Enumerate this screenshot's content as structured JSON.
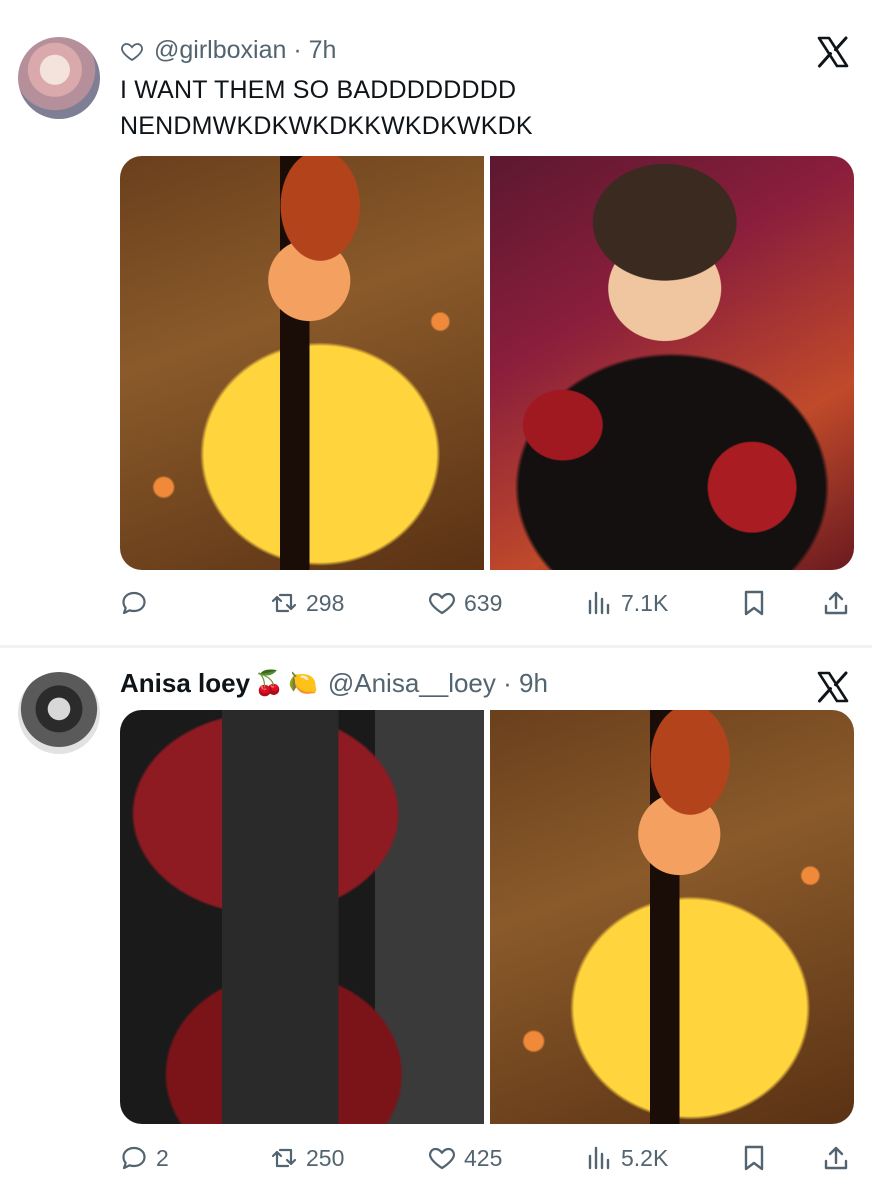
{
  "tweets": [
    {
      "handle": "@girlboxian",
      "time": "7h",
      "text_line1": "I WANT THEM SO BADDDDDDDD",
      "text_line2": "NENDMWKDKWKDKKWKDKWKDK",
      "stats": {
        "replies": "",
        "retweets": "298",
        "likes": "639",
        "views": "7.1K"
      },
      "photos": [
        "yellow-shirt-performer",
        "black-embroidered-jacket-performer"
      ]
    },
    {
      "name": "Anisa loey",
      "emojis": [
        "🍒",
        "🍋"
      ],
      "handle": "@Anisa__loey",
      "time": "9h",
      "stats": {
        "replies": "2",
        "retweets": "250",
        "likes": "425",
        "views": "5.2K"
      },
      "photos": [
        "red-velvet-buckle-jacket",
        "yellow-shirt-performer"
      ]
    }
  ],
  "icons": {
    "like": "heart-icon",
    "reply": "reply-bubble-icon",
    "retweet": "retweet-icon",
    "views": "views-bar-icon",
    "bookmark": "bookmark-icon",
    "share": "share-icon",
    "platform": "x-logo-icon"
  },
  "colors": {
    "text": "#0f1419",
    "secondary": "#536471",
    "divider": "#eff3f4"
  }
}
